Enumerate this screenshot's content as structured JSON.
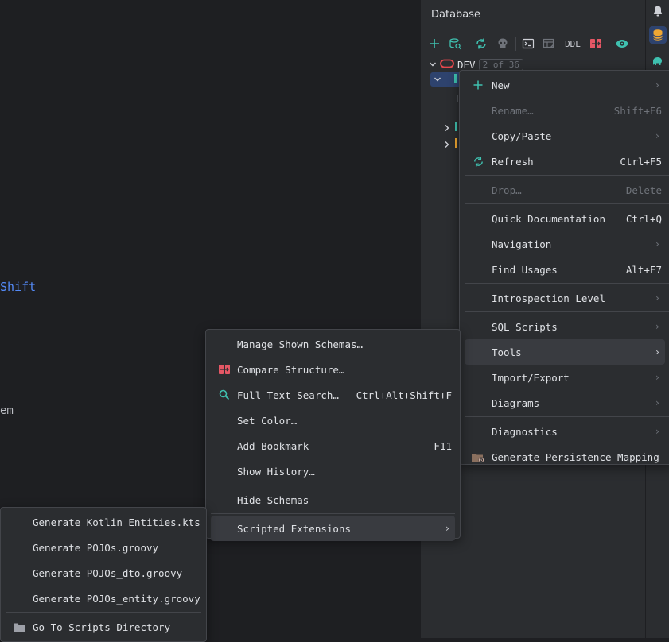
{
  "editor": {
    "fragment_shift": "Shift",
    "fragment_em": "em"
  },
  "database_panel": {
    "title": "Database",
    "toolbar": {
      "ddl_label": "DDL"
    },
    "tree": {
      "datasource_name": "DEV",
      "datasource_badge": "2 of 36"
    }
  },
  "context_menu": {
    "items": [
      {
        "label": "New",
        "shortcut": "",
        "submenu": true,
        "icon": "plus-icon"
      },
      {
        "label": "Rename…",
        "shortcut": "Shift+F6",
        "disabled": true
      },
      {
        "label": "Copy/Paste",
        "shortcut": "",
        "submenu": true
      },
      {
        "label": "Refresh",
        "shortcut": "Ctrl+F5",
        "icon": "refresh-icon"
      },
      {
        "label": "Drop…",
        "shortcut": "Delete",
        "disabled": true
      },
      {
        "label": "Quick Documentation",
        "shortcut": "Ctrl+Q"
      },
      {
        "label": "Navigation",
        "shortcut": "",
        "submenu": true
      },
      {
        "label": "Find Usages",
        "shortcut": "Alt+F7"
      },
      {
        "label": "Introspection Level",
        "shortcut": "",
        "submenu": true
      },
      {
        "label": "SQL Scripts",
        "shortcut": "",
        "submenu": true
      },
      {
        "label": "Tools",
        "shortcut": "",
        "submenu": true,
        "highlighted": true
      },
      {
        "label": "Import/Export",
        "shortcut": "",
        "submenu": true
      },
      {
        "label": "Diagrams",
        "shortcut": "",
        "submenu": true
      },
      {
        "label": "Diagnostics",
        "shortcut": "",
        "submenu": true
      },
      {
        "label": "Generate Persistence Mapping",
        "shortcut": "",
        "icon": "persistence-folder-icon"
      }
    ]
  },
  "tools_menu": {
    "items": [
      {
        "label": "Manage Shown Schemas…",
        "shortcut": ""
      },
      {
        "label": "Compare Structure…",
        "shortcut": "",
        "icon": "compare-icon"
      },
      {
        "label": "Full-Text Search…",
        "shortcut": "Ctrl+Alt+Shift+F",
        "icon": "search-icon"
      },
      {
        "label": "Set Color…",
        "shortcut": ""
      },
      {
        "label": "Add Bookmark",
        "shortcut": "F11"
      },
      {
        "label": "Show History…",
        "shortcut": ""
      },
      {
        "label": "Hide Schemas",
        "shortcut": ""
      },
      {
        "label": "Scripted Extensions",
        "shortcut": "",
        "submenu": true,
        "highlighted": true
      }
    ]
  },
  "scripted_extensions_menu": {
    "items": [
      {
        "label": "Generate Kotlin Entities.kts"
      },
      {
        "label": "Generate POJOs.groovy"
      },
      {
        "label": "Generate POJOs_dto.groovy"
      },
      {
        "label": "Generate POJOs_entity.groovy"
      },
      {
        "label": "Go To Scripts Directory",
        "icon": "folder-icon"
      }
    ]
  },
  "colors": {
    "background": "#1e1f22",
    "panel": "#2b2d30",
    "highlight": "#393b40",
    "accent": "#3574f0",
    "link": "#548af7"
  }
}
